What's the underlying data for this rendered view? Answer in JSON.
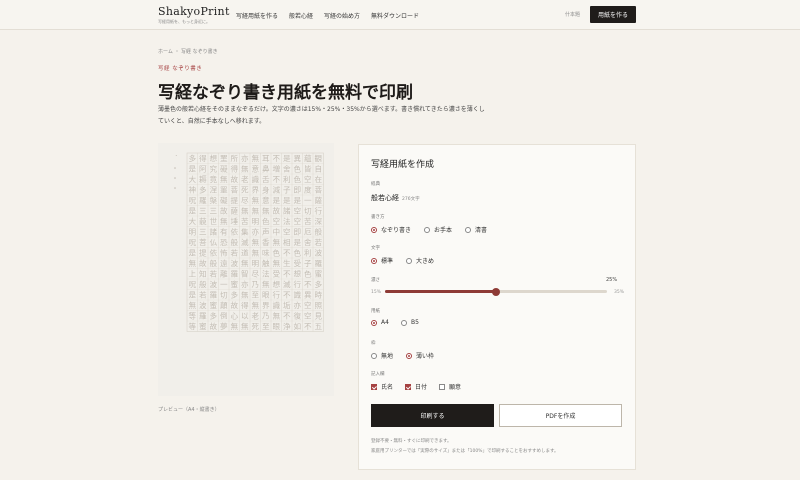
{
  "header": {
    "logo": "ShakyoPrint",
    "tagline": "写経用紙を、もっと身近に。",
    "nav": [
      "写経用紙を作る",
      "般若心経",
      "写経の始め方",
      "無料ダウンロード"
    ],
    "login": "什本題",
    "cta": "用紙を作る"
  },
  "breadcrumb": "ホーム ・ 写経 なぞり書き",
  "eyebrow": "写経 なぞり書き",
  "title": "写経なぞり書き用紙を無料で印刷",
  "description": "薄墨色の般若心経をそのままなぞるだけ。文字の濃さは15%・25%・35%から選べます。書き慣れてきたら濃さを薄くしていくと、自然に手本なしへ移れます。",
  "preview": {
    "caption": "プレビュー（A4・縦書き）",
    "colors": {
      "grid": "#d8d2c8",
      "ink": "#c4beb5"
    },
    "text": "観自在菩薩行深般若波羅蜜多時照見五蘊皆空度一切苦厄舍利子色不異空空不異色色即是空空即是色受想行識亦復如是舍利子是諸法空相不生不滅不垢不浄不増不減是故空中無色無受想行識無眼耳鼻舌身意無色声香味触法無眼界乃至無意識界無無明亦無無明尽乃至無老死亦無老死尽無苦集滅道無智亦無得以無所得故菩提薩埵依般若波羅蜜多故心無罣礙無罣礙故無有恐怖遠離一切顛倒夢想究竟涅槃三世諸仏依般若波羅蜜多故得阿耨多羅三藐三菩提故知般若波羅蜜多是大神呪是大明呪是無上呪是無等等呪能除一切苦真実不虚故説般若波羅蜜多呪即説呪曰羯諦羯諦波羅羯諦波羅僧羯諦菩提薩婆訶般若心経",
    "title_col": "般若波羅蜜多心経"
  },
  "form": {
    "title": "写経用紙を作成",
    "sutra_label": "経典",
    "sutra_value": "般若心経",
    "sutra_sub": "276文字",
    "style_label": "書き方",
    "style_options": [
      "なぞり書き",
      "お手本",
      "清書"
    ],
    "size_label": "文字",
    "size_options": [
      "標準",
      "大きめ"
    ],
    "density_label": "濃さ",
    "density_value": "25%",
    "density_level": 0.5,
    "density_min": "15%",
    "density_max": "35%",
    "paper_label": "用紙",
    "paper_options": [
      "A4",
      "B5"
    ],
    "frame_label": "枠",
    "frame_options": [
      "無地",
      "薄い枠"
    ],
    "fields_label": "記入欄",
    "fields_options": [
      "氏名",
      "日付",
      "願意"
    ],
    "print_button": "印刷する",
    "pdf_button": "PDFを作成",
    "note1": "登録不要・無料・すぐに印刷できます。",
    "note2": "家庭用プリンターでは「実際のサイズ」または「100%」で印刷することをおすすめします。",
    "accent": "#a64242"
  }
}
